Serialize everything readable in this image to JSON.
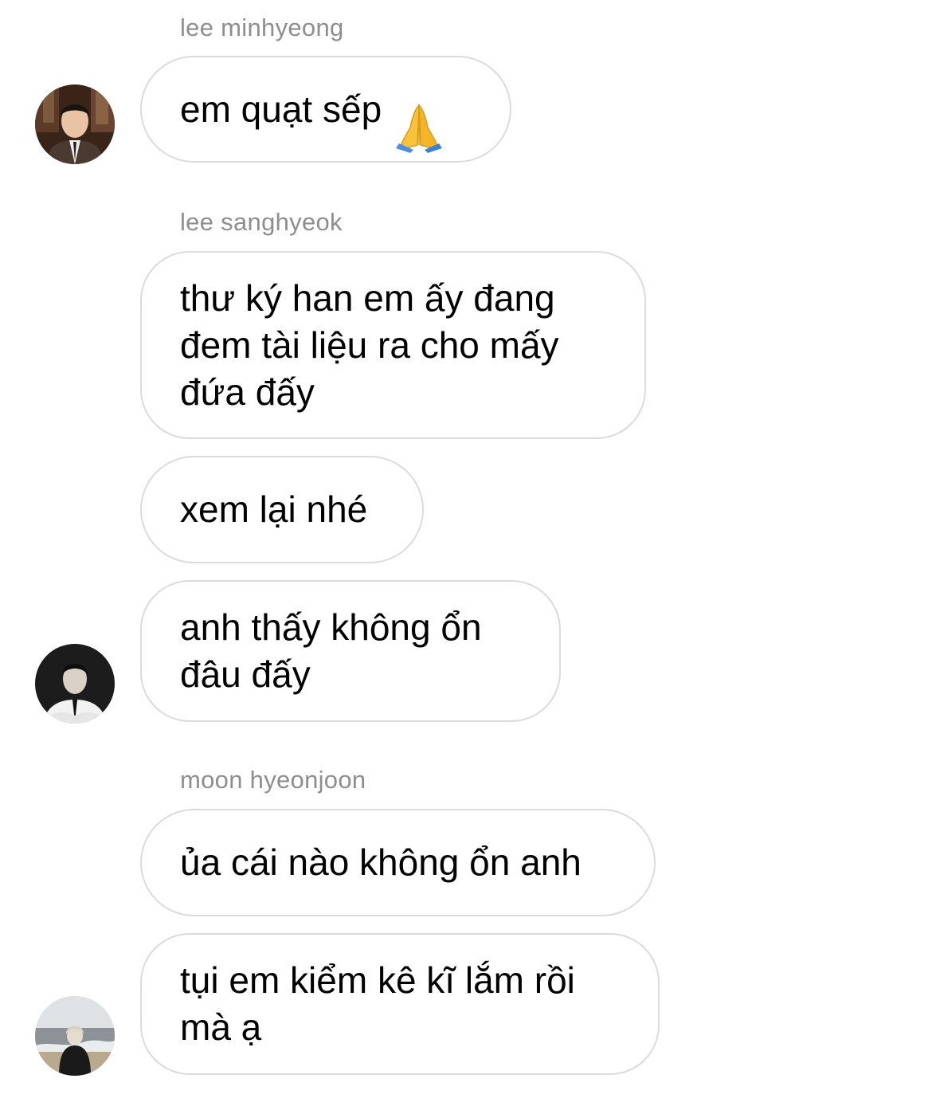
{
  "messages": [
    {
      "sender": "lee minhyeong",
      "bubbles": [
        {
          "text": "em quạt sếp",
          "emoji": "folded-hands-emoji"
        }
      ],
      "avatar": "avatar-lee-minhyeong"
    },
    {
      "sender": "lee sanghyeok",
      "bubbles": [
        {
          "text": "thư ký han em ấy đang\nđem tài liệu ra cho mấy\nđứa đấy"
        },
        {
          "text": "xem lại nhé"
        },
        {
          "text": "anh thấy không ổn\nđâu đấy"
        }
      ],
      "avatar": "avatar-lee-sanghyeok"
    },
    {
      "sender": "moon hyeonjoon",
      "bubbles": [
        {
          "text": "ủa cái nào không ổn anh"
        },
        {
          "text": "tụi em kiểm kê kĩ lắm rồi\nmà ạ"
        }
      ],
      "avatar": "avatar-moon-hyeonjoon"
    }
  ],
  "colors": {
    "bubble_border": "#dbdbdb",
    "sender_text": "#8e8e8e",
    "message_text": "#000000",
    "background": "#ffffff"
  }
}
